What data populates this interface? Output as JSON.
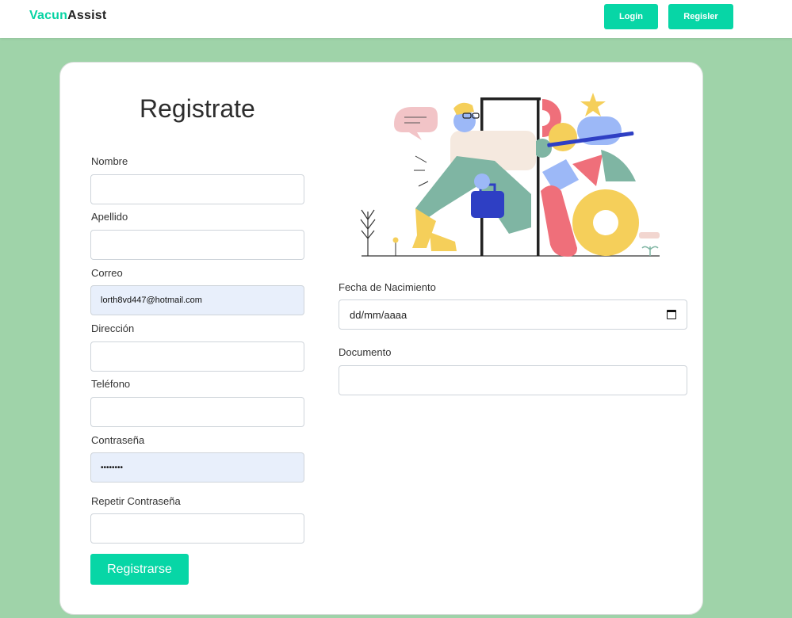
{
  "navbar": {
    "brand_part1": "Vacun",
    "brand_part2": "Assist",
    "login_label": "Login",
    "register_label": "Regisler"
  },
  "form": {
    "title": "Registrate",
    "fields": {
      "nombre": {
        "label": "Nombre",
        "value": ""
      },
      "apellido": {
        "label": "Apellido",
        "value": ""
      },
      "correo": {
        "label": "Correo",
        "value": "lorth8vd447@hotmail.com"
      },
      "direccion": {
        "label": "Dirección",
        "value": ""
      },
      "telefono": {
        "label": "Teléfono",
        "value": ""
      },
      "contrasena": {
        "label": "Contraseña",
        "value": "••••••••"
      },
      "repetir": {
        "label": "Repetir Contraseña",
        "value": ""
      },
      "fecha": {
        "label": "Fecha de Nacimiento",
        "placeholder": "dd/mm/aaaa"
      },
      "documento": {
        "label": "Documento",
        "value": ""
      }
    },
    "submit_label": "Registrarse"
  },
  "colors": {
    "accent": "#07d6a6",
    "background": "#9fd3a9",
    "autofill": "#e8effb"
  }
}
